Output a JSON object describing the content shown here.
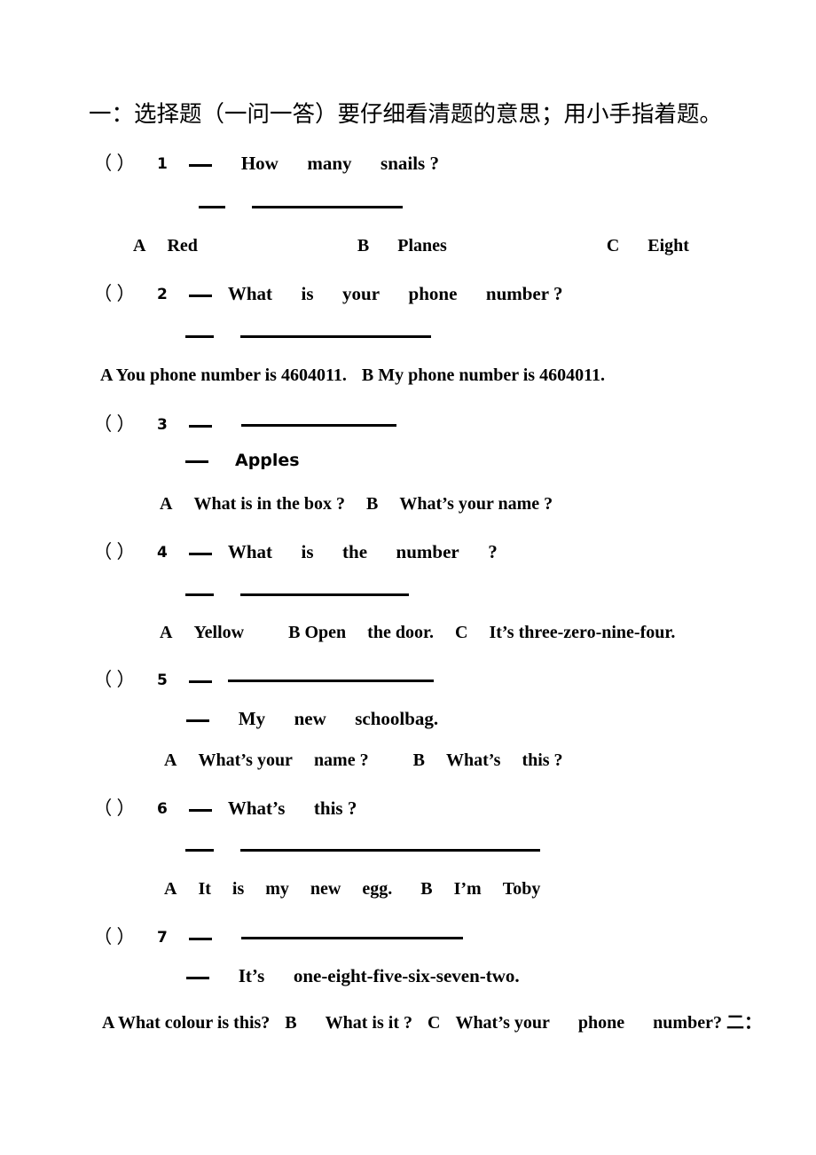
{
  "document": {
    "section_title": "一：选择题（一问一答）要仔细看清题的意思；用小手指着题。",
    "bracket_open": "（",
    "bracket_close": "）",
    "trailing_marker": "二："
  },
  "questions": [
    {
      "number": "1",
      "stem": "How   many   snails ?",
      "answer_text": "",
      "options_line": "A   Red                    B     Planes                   C    Eight",
      "options": [
        {
          "letter": "A",
          "text": "Red"
        },
        {
          "letter": "B",
          "text": "Planes"
        },
        {
          "letter": "C",
          "text": "Eight"
        }
      ]
    },
    {
      "number": "2",
      "stem": "What   is   your   phone   number ?",
      "answer_text": "",
      "options_line": "A You   phone    number is 4604011. B My phone    number is 4604011.",
      "options": [
        {
          "letter": "A",
          "text": "You   phone    number is 4604011."
        },
        {
          "letter": "B",
          "text": "My phone    number is 4604011."
        }
      ]
    },
    {
      "number": "3",
      "stem": "",
      "answer_text": "Apples",
      "options_line": "A   What   is   in   the   box ?  B   What’s   your name ?",
      "options": [
        {
          "letter": "A",
          "text": "What   is   in   the   box ?"
        },
        {
          "letter": "B",
          "text": "What’s   your name ?"
        }
      ]
    },
    {
      "number": "4",
      "stem": "What   is   the   number   ?",
      "answer_text": "",
      "options_line": "A   Yellow      B Open   the door.   C   It’s three-zero-nine-four.",
      "options": [
        {
          "letter": "A",
          "text": "Yellow"
        },
        {
          "letter": "B",
          "text": "Open   the door."
        },
        {
          "letter": "C",
          "text": "It’s three-zero-nine-four."
        }
      ]
    },
    {
      "number": "5",
      "stem": "",
      "answer_text": "My   new   schoolbag.",
      "options_line": "A   What’s your   name ?    B   What’s   this ?",
      "options": [
        {
          "letter": "A",
          "text": "What’s your   name ?"
        },
        {
          "letter": "B",
          "text": "What’s   this ?"
        }
      ]
    },
    {
      "number": "6",
      "stem": "What’s   this ?",
      "answer_text": "",
      "options_line": "A   It   is   my   new   egg.   B   I’m   Toby",
      "options": [
        {
          "letter": "A",
          "text": "It   is   my   new   egg."
        },
        {
          "letter": "B",
          "text": "I’m   Toby"
        }
      ]
    },
    {
      "number": "7",
      "stem": "",
      "answer_text": "It’s   one-eight-five-six-seven-two.",
      "options_line": "A What colour is this? B   What is it ? C What’s your   phone   number?",
      "options": [
        {
          "letter": "A",
          "text": "What colour is this?"
        },
        {
          "letter": "B",
          "text": "What is it ?"
        },
        {
          "letter": "C",
          "text": "What’s your   phone   number?"
        }
      ]
    }
  ],
  "q1": {
    "opt_a_letter": "A",
    "opt_a_text": "Red",
    "opt_b_letter": "B",
    "opt_b_text": "Planes",
    "opt_c_letter": "C",
    "opt_c_text": "Eight"
  },
  "q2": {
    "stem_w1": "What",
    "stem_w2": "is",
    "stem_w3": "your",
    "stem_w4": "phone",
    "stem_w5": "number ?",
    "opt_a": "A You   phone    number is 4604011.",
    "opt_b": "B My phone    number is 4604011."
  },
  "q3": {
    "answer": "Apples",
    "opt_a_letter": "A",
    "opt_a_text": "What   is   in   the   box ?",
    "opt_b_letter": "B",
    "opt_b_text": "What’s   your name ?"
  },
  "q4": {
    "stem_w1": "What",
    "stem_w2": "is",
    "stem_w3": "the",
    "stem_w4": "number",
    "stem_w5": "?",
    "opt_a_letter": "A",
    "opt_a_text": "Yellow",
    "opt_b": "B Open",
    "opt_b_text": "the door.",
    "opt_c_letter": "C",
    "opt_c_text": "It’s three-zero-nine-four."
  },
  "q5": {
    "answer_w1": "My",
    "answer_w2": "new",
    "answer_w3": "schoolbag.",
    "opt_a_letter": "A",
    "opt_a_text": "What’s your",
    "opt_a_text2": "name ?",
    "opt_b_letter": "B",
    "opt_b_text": "What’s",
    "opt_b_text2": "this ?"
  },
  "q6": {
    "stem_w1": "What’s",
    "stem_w2": "this ?",
    "opt_a_letter": "A",
    "opt_a_w1": "It",
    "opt_a_w2": "is",
    "opt_a_w3": "my",
    "opt_a_w4": "new",
    "opt_a_w5": "egg.",
    "opt_b_letter": "B",
    "opt_b_w1": "I’m",
    "opt_b_w2": "Toby"
  },
  "q7": {
    "answer_w1": "It’s",
    "answer_w2": "one-eight-five-six-seven-two.",
    "opt_a": "A What colour is this?",
    "opt_b_letter": "B",
    "opt_b_text": "What is it ?",
    "opt_c_letter": "C",
    "opt_c_text": "What’s your",
    "opt_c_text2": "phone",
    "opt_c_text3": "number?"
  },
  "q1_stem": {
    "w1": "How",
    "w2": "many",
    "w3": "snails ?"
  }
}
